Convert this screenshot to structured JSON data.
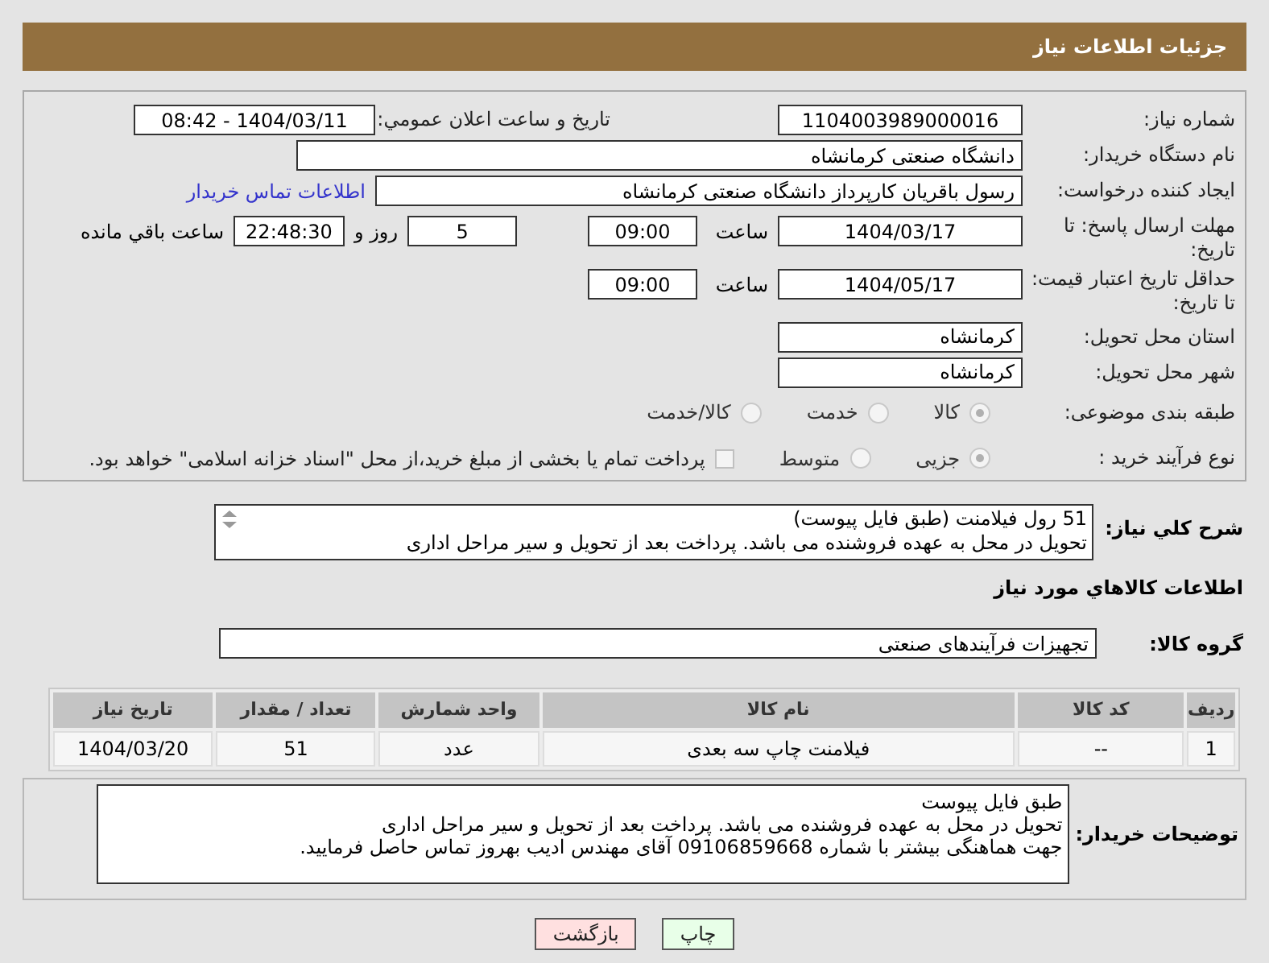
{
  "header": {
    "title": "جزئیات اطلاعات نیاز"
  },
  "form": {
    "need_number": {
      "label": "شماره نیاز:",
      "value": "1104003989000016"
    },
    "announce": {
      "label": "تاریخ و ساعت اعلان عمومي:",
      "value": "1404/03/11 - 08:42"
    },
    "buyer": {
      "label": "نام دستگاه خریدار:",
      "value": "دانشگاه صنعتی کرمانشاه"
    },
    "creator": {
      "label": "ایجاد کننده درخواست:",
      "value": "رسول باقریان کارپرداز دانشگاه صنعتی کرمانشاه",
      "link": "اطلاعات تماس خریدار"
    },
    "deadline": {
      "label": "مهلت ارسال پاسخ: تا تاریخ:",
      "date": "1404/03/17",
      "time_label": "ساعت",
      "time": "09:00",
      "days": "5",
      "days_label": "روز و",
      "remaining": "22:48:30",
      "remaining_label": "ساعت باقي مانده"
    },
    "validity": {
      "label": "حداقل تاریخ اعتبار قیمت: تا تاریخ:",
      "date": "1404/05/17",
      "time_label": "ساعت",
      "time": "09:00"
    },
    "province": {
      "label": "استان محل تحویل:",
      "value": "کرمانشاه"
    },
    "city": {
      "label": "شهر محل تحویل:",
      "value": "کرمانشاه"
    },
    "category": {
      "label": "طبقه بندی موضوعی:",
      "options": [
        {
          "label": "کالا",
          "selected": true
        },
        {
          "label": "خدمت",
          "selected": false
        },
        {
          "label": "کالا/خدمت",
          "selected": false
        }
      ]
    },
    "process": {
      "label": "نوع فرآیند خرید :",
      "options": [
        {
          "label": "جزیی",
          "selected": true
        },
        {
          "label": "متوسط",
          "selected": false
        }
      ],
      "payment": {
        "label": "پرداخت تمام یا بخشی از مبلغ خرید،از محل \"اسناد خزانه اسلامی\" خواهد بود.",
        "checked": false
      }
    }
  },
  "description": {
    "label": "شرح کلي نیاز:",
    "text": "51 رول فیلامنت (طبق فایل پیوست)\nتحویل در محل به عهده فروشنده می باشد. پرداخت بعد از تحویل و سیر مراحل اداری"
  },
  "goods": {
    "title": "اطلاعات کالاهاي مورد نیاز",
    "group_label": "گروه کالا:",
    "group": "تجهیزات فرآیندهای صنعتی",
    "columns": [
      "ردیف",
      "کد کالا",
      "نام کالا",
      "واحد شمارش",
      "تعداد / مقدار",
      "تاریخ نیاز"
    ],
    "rows": [
      [
        "1",
        "--",
        "فیلامنت چاپ سه بعدی",
        "عدد",
        "51",
        "1404/03/20"
      ]
    ]
  },
  "notes": {
    "label": "توضیحات خریدار:",
    "text": "طبق فایل پیوست\nتحویل در محل به عهده فروشنده می باشد. پرداخت بعد از تحویل و سیر مراحل اداری\nجهت هماهنگی بیشتر با شماره 09106859668 آقای مهندس ادیب بهروز تماس حاصل فرمایید."
  },
  "buttons": [
    {
      "label": "چاپ",
      "kind": "print"
    },
    {
      "label": "بازگشت",
      "kind": "back"
    }
  ]
}
